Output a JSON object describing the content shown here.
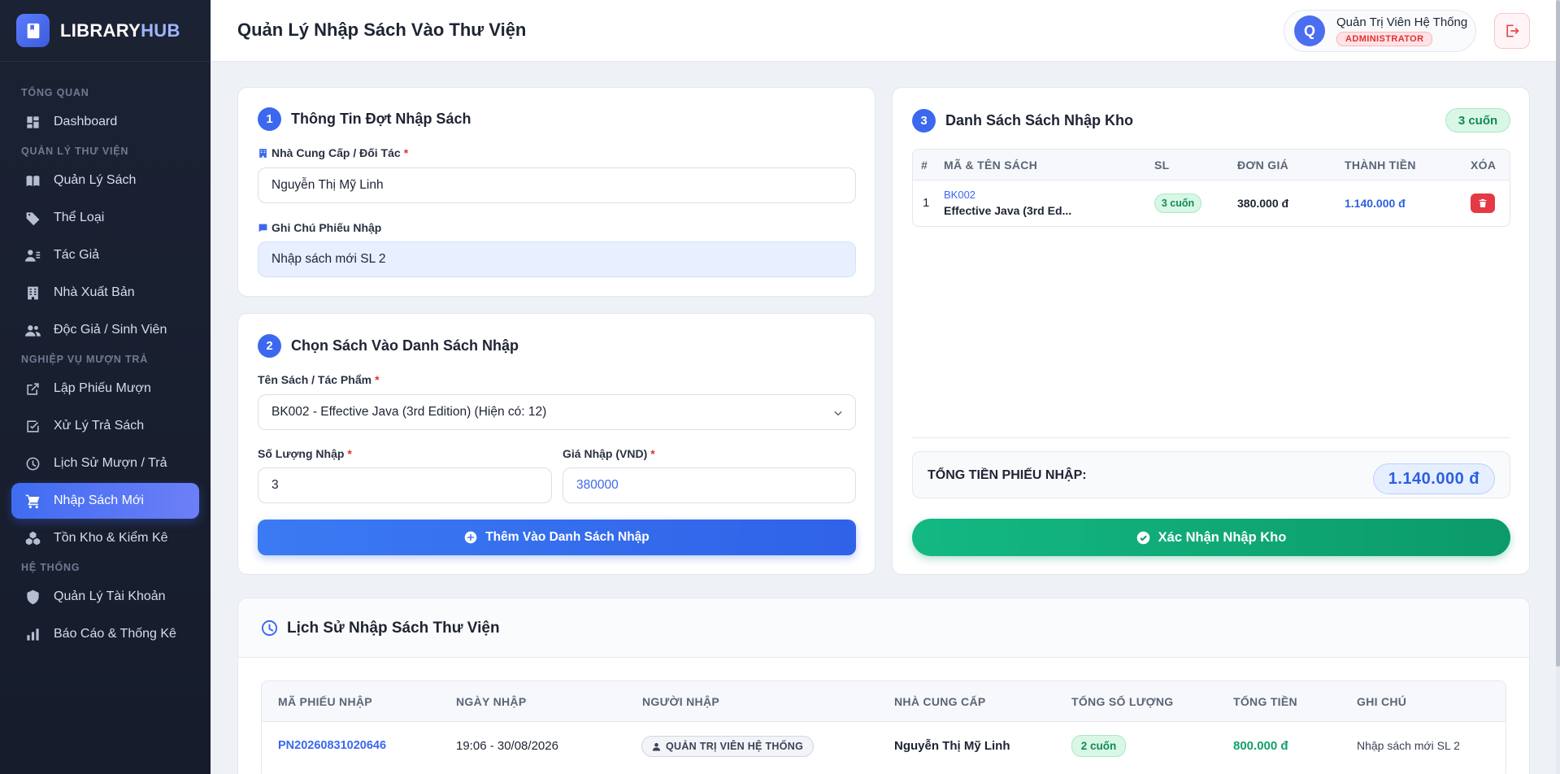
{
  "brand": {
    "name_a": "LIBRARY",
    "name_b": "HUB"
  },
  "sidebar": {
    "sections": [
      {
        "title": "TỔNG QUAN"
      },
      {
        "title": "QUẢN LÝ THƯ VIỆN"
      },
      {
        "title": "NGHIỆP VỤ MƯỢN TRẢ"
      },
      {
        "title": "HỆ THỐNG"
      }
    ],
    "items": [
      {
        "label": "Dashboard",
        "icon": "dashboard-icon"
      },
      {
        "label": "Quản Lý Sách",
        "icon": "book-icon"
      },
      {
        "label": "Thể Loại",
        "icon": "tag-icon"
      },
      {
        "label": "Tác Giả",
        "icon": "author-icon"
      },
      {
        "label": "Nhà Xuất Bản",
        "icon": "building-icon"
      },
      {
        "label": "Độc Giả / Sinh Viên",
        "icon": "users-icon"
      },
      {
        "label": "Lập Phiếu Mượn",
        "icon": "external-link-icon"
      },
      {
        "label": "Xử Lý Trả Sách",
        "icon": "check-edit-icon"
      },
      {
        "label": "Lịch Sử Mượn / Trả",
        "icon": "clock-icon"
      },
      {
        "label": "Nhập Sách Mới",
        "icon": "cart-icon",
        "active": true
      },
      {
        "label": "Tồn Kho & Kiểm Kê",
        "icon": "boxes-icon"
      },
      {
        "label": "Quản Lý Tài Khoản",
        "icon": "shield-icon"
      },
      {
        "label": "Báo Cáo & Thống Kê",
        "icon": "bar-chart-icon"
      }
    ]
  },
  "header": {
    "title": "Quản Lý Nhập Sách Vào Thư Viện",
    "user": {
      "initial": "Q",
      "name": "Quản Trị Viên Hệ Thống",
      "role": "ADMINISTRATOR"
    }
  },
  "step1": {
    "num": "1",
    "title": "Thông Tin Đợt Nhập Sách",
    "supplier_label": "Nhà Cung Cấp / Đối Tác",
    "supplier_value": "Nguyễn Thị Mỹ Linh",
    "note_label": "Ghi Chú Phiếu Nhập",
    "note_value": "Nhập sách mới SL 2"
  },
  "step2": {
    "num": "2",
    "title": "Chọn Sách Vào Danh Sách Nhập",
    "book_label": "Tên Sách / Tác Phẩm",
    "book_value": "BK002 - Effective Java (3rd Edition) (Hiện có: 12)",
    "qty_label": "Số Lượng Nhập",
    "qty_value": "3",
    "price_label": "Giá Nhập (VND)",
    "price_value": "380000",
    "add_button": "Thêm Vào Danh Sách Nhập"
  },
  "step3": {
    "num": "3",
    "title": "Danh Sách Sách Nhập Kho",
    "count": "3 cuốn",
    "columns": [
      "#",
      "MÃ & TÊN SÁCH",
      "SL",
      "ĐƠN GIÁ",
      "THÀNH TIỀN",
      "XÓA"
    ],
    "rows": [
      {
        "idx": "1",
        "code": "BK002",
        "name": "Effective Java (3rd Ed...",
        "qty": "3 cuốn",
        "price": "380.000 đ",
        "total": "1.140.000 đ"
      }
    ],
    "total_label": "TỔNG TIỀN PHIẾU NHẬP:",
    "total_value": "1.140.000 đ",
    "confirm_button": "Xác Nhận Nhập Kho"
  },
  "history": {
    "title": "Lịch Sử Nhập Sách Thư Viện",
    "columns": [
      "MÃ PHIẾU NHẬP",
      "NGÀY NHẬP",
      "NGƯỜI NHẬP",
      "NHÀ CUNG CẤP",
      "TỔNG SỐ LƯỢNG",
      "TỔNG TIỀN",
      "GHI CHÚ"
    ],
    "rows": [
      {
        "id": "PN20260831020646",
        "date": "19:06 - 30/08/2026",
        "user": "QUẢN TRỊ VIÊN HỆ THỐNG",
        "supplier": "Nguyễn Thị Mỹ Linh",
        "qty": "2 cuốn",
        "total": "800.000 đ",
        "note": "Nhập sách mới SL 2"
      }
    ]
  },
  "colors": {
    "primary": "#3b68ee",
    "success": "#13b883",
    "danger": "#e53946",
    "sidebar": "#1b2233"
  }
}
